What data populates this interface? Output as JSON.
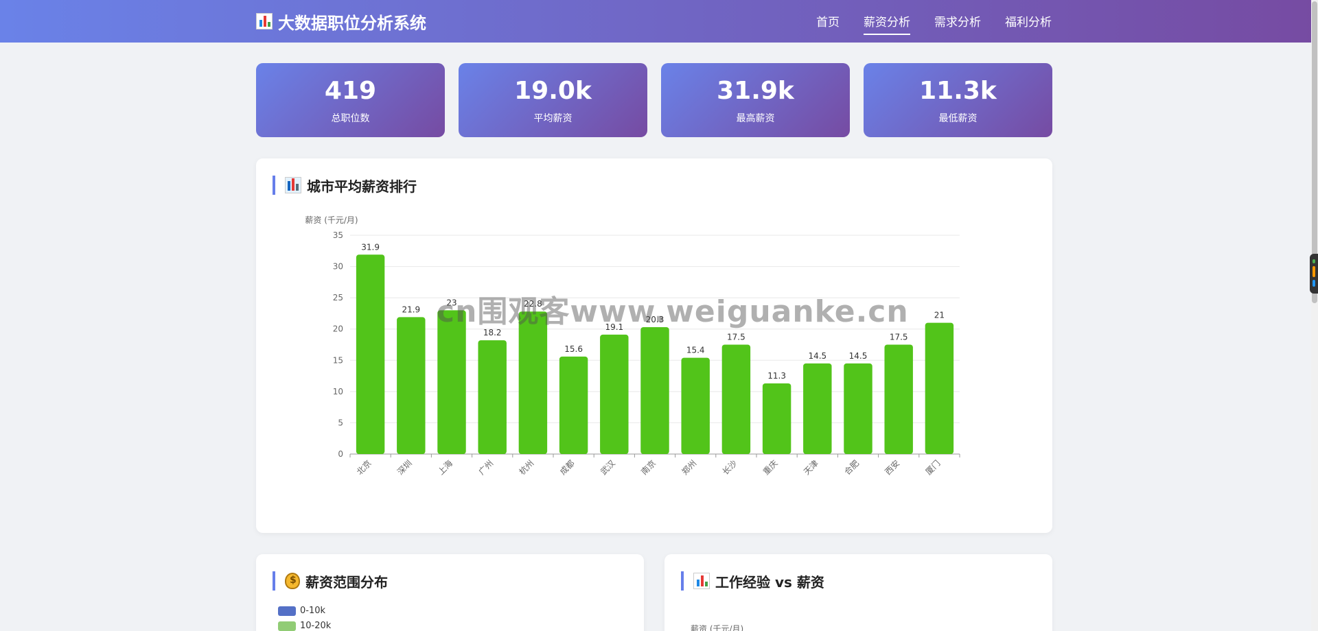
{
  "navbar": {
    "title": "大数据职位分析系统",
    "brand_icon": "bar-chart-icon",
    "links": [
      {
        "label": "首页",
        "active": false
      },
      {
        "label": "薪资分析",
        "active": true
      },
      {
        "label": "需求分析",
        "active": false
      },
      {
        "label": "福利分析",
        "active": false
      }
    ]
  },
  "stats": [
    {
      "value": "419",
      "label": "总职位数"
    },
    {
      "value": "19.0k",
      "label": "平均薪资"
    },
    {
      "value": "31.9k",
      "label": "最高薪资"
    },
    {
      "value": "11.3k",
      "label": "最低薪资"
    }
  ],
  "city_panel": {
    "title": "城市平均薪资排行",
    "icon": "city-icon"
  },
  "salary_range_panel": {
    "title": "薪资范围分布",
    "icon": "money-bag-icon",
    "legend": [
      {
        "label": "0-10k",
        "color": "#5470c6"
      },
      {
        "label": "10-20k",
        "color": "#91cc75"
      }
    ]
  },
  "experience_panel": {
    "title": "工作经验 vs 薪资",
    "icon": "bar-chart-icon",
    "ylabel": "薪资 (千元/月)"
  },
  "watermark": "cn围观客www.weiguanke.cn",
  "chart_data": {
    "type": "bar",
    "ylabel": "薪资 (千元/月)",
    "ylim": [
      0,
      35
    ],
    "yticks": [
      0,
      5,
      10,
      15,
      20,
      25,
      30,
      35
    ],
    "grid": true,
    "bar_color": "#52c41a",
    "categories": [
      "北京",
      "深圳",
      "上海",
      "广州",
      "杭州",
      "成都",
      "武汉",
      "南京",
      "郑州",
      "长沙",
      "重庆",
      "天津",
      "合肥",
      "西安",
      "厦门"
    ],
    "values": [
      31.9,
      21.9,
      23,
      18.2,
      22.8,
      15.6,
      19.1,
      20.3,
      15.4,
      17.5,
      11.3,
      14.5,
      14.5,
      17.5,
      21
    ]
  }
}
